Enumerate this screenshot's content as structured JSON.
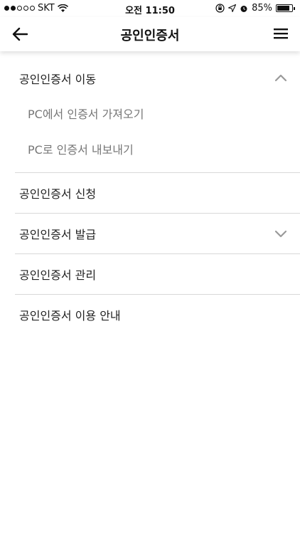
{
  "status_bar": {
    "carrier": "SKT",
    "time": "오전 11:50",
    "battery": "85%",
    "battery_level": 0.85,
    "signal_bars_filled": 2,
    "signal_bars_total": 5,
    "icons": [
      "wifi-icon",
      "orientation-lock-icon",
      "location-arrow-icon",
      "alarm-icon",
      "battery-icon"
    ]
  },
  "header": {
    "title": "공인인증서",
    "back_icon": "arrow-left-icon",
    "menu_icon": "hamburger-menu-icon"
  },
  "menu": {
    "items": [
      {
        "label": "공인인증서 이동",
        "expanded": true,
        "chevron": "chevron-up-icon",
        "sub_items": [
          {
            "label": "PC에서 인증서 가져오기"
          },
          {
            "label": "PC로 인증서 내보내기"
          }
        ]
      },
      {
        "label": "공인인증서 신청"
      },
      {
        "label": "공인인증서 발급",
        "expanded": false,
        "chevron": "chevron-down-icon"
      },
      {
        "label": "공인인증서 관리"
      },
      {
        "label": "공인인증서 이용 안내"
      }
    ]
  },
  "colors": {
    "background": "#ffffff",
    "text": "#222222",
    "sub_text": "#777777",
    "divider": "#d8d8d8",
    "chevron": "#9a9a9a"
  }
}
